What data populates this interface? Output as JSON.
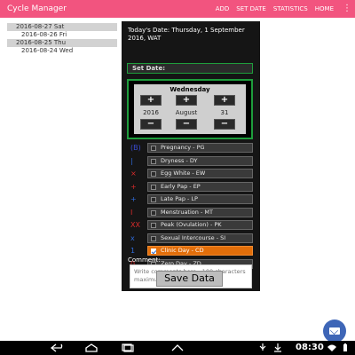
{
  "app": {
    "title": "Cycle Manager",
    "actions": [
      "ADD",
      "SET DATE",
      "STATISTICS",
      "HOME"
    ],
    "overflow": "⋮"
  },
  "date_list": [
    {
      "text": "2016-08-27 Sat",
      "highlighted": true
    },
    {
      "text": "2016-08-26 Fri",
      "highlighted": false
    },
    {
      "text": "2016-08-25 Thu",
      "highlighted": true
    },
    {
      "text": "2016-08-24 Wed",
      "highlighted": false
    }
  ],
  "dialog": {
    "today": "Today's Date: Thursday, 1 September 2016, WAT",
    "set_date_label": "Set Date:",
    "picker": {
      "weekday": "Wednesday",
      "year": "2016",
      "month": "August",
      "day": "31",
      "plus": "+",
      "minus": "−"
    },
    "rows": [
      {
        "marker": "(B)",
        "marker_color": "#3a4bd0",
        "label": "Pregnancy - PG",
        "checked": false
      },
      {
        "marker": "|",
        "marker_color": "#2f6bd9",
        "label": "Dryness - DY",
        "checked": false
      },
      {
        "marker": "×",
        "marker_color": "#d92b2b",
        "label": "Egg White - EW",
        "checked": false
      },
      {
        "marker": "+",
        "marker_color": "#d92b2b",
        "label": "Early Pap - EP",
        "checked": false
      },
      {
        "marker": "+",
        "marker_color": "#2f6bd9",
        "label": "Late Pap - LP",
        "checked": false
      },
      {
        "marker": "I",
        "marker_color": "#d92b2b",
        "label": "Menstruation - MT",
        "checked": false
      },
      {
        "marker": "XX",
        "marker_color": "#d92b2b",
        "label": "Peak (Ovulation) - PK",
        "checked": false
      },
      {
        "marker": "x",
        "marker_color": "#2f6bd9",
        "label": "Sexual Intercourse - SI",
        "checked": false
      },
      {
        "marker": "1",
        "marker_color": "#2f6bd9",
        "label": "Clinic Day - CD",
        "checked": true
      },
      {
        "marker": "0",
        "marker_color": "#d92b2b",
        "label": "Zero Day - ZD",
        "checked": false
      }
    ],
    "comment_label": "Comment:",
    "comment_placeholder": "Write comments here - 100 characters maximum",
    "save_label": "Save Data"
  },
  "status_bar": {
    "clock": "08:30"
  },
  "colors": {
    "accent": "#f2547f",
    "dialog_bg": "#151515",
    "green_border": "#1e9d3c",
    "checked_row": "#e26e0a",
    "fab": "#3e66b7"
  }
}
